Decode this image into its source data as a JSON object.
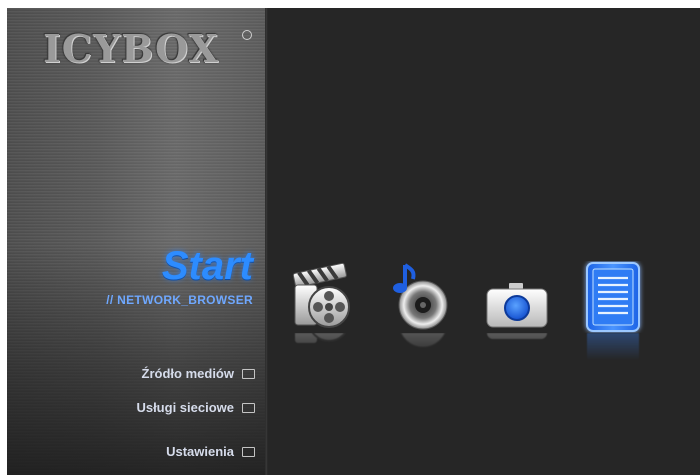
{
  "brand": {
    "logo_text": "ICYBOX"
  },
  "section": {
    "title": "Start",
    "breadcrumb": "// NETWORK_BROWSER"
  },
  "menu": {
    "items": [
      {
        "label": "Źródło mediów"
      },
      {
        "label": "Usługi sieciowe"
      },
      {
        "label": "Ustawienia"
      }
    ]
  },
  "icons": [
    {
      "name": "movie-icon",
      "selected": false
    },
    {
      "name": "music-icon",
      "selected": false
    },
    {
      "name": "photo-icon",
      "selected": false
    },
    {
      "name": "file-list-icon",
      "selected": true
    }
  ],
  "colors": {
    "accent": "#2d8cff",
    "background": "#262626"
  }
}
